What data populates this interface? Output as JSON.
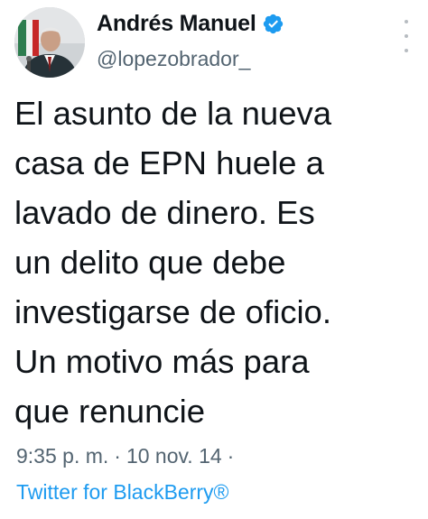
{
  "author": {
    "display_name": "Andrés Manuel",
    "handle": "@lopezobrador_",
    "verified_icon": "verified-badge-icon",
    "avatar": "profile-photo"
  },
  "tweet": {
    "text": "El asunto de la nueva\ncasa de EPN huele a\nlavado de dinero. Es\nun delito que debe\ninvestigarse de oficio.\nUn motivo más para\nque renuncie"
  },
  "meta": {
    "time": "9:35 p. m.",
    "separator": "·",
    "date": "10 nov. 14",
    "trailing_separator": "·",
    "source": "Twitter for BlackBerry®"
  },
  "colors": {
    "text": "#0f1419",
    "secondary": "#536471",
    "link": "#1d9bf0",
    "verified": "#1d9bf0"
  }
}
